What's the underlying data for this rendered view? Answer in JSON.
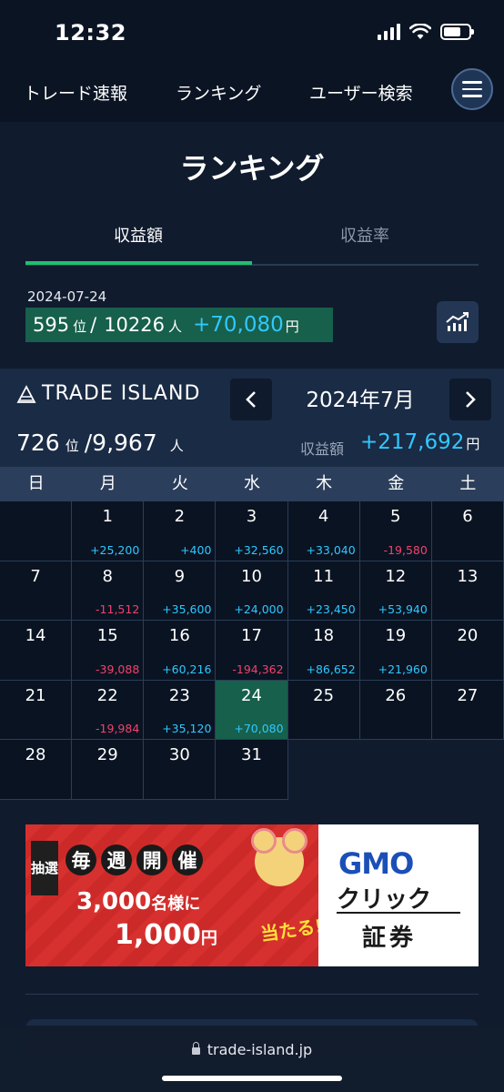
{
  "status_bar": {
    "time": "12:32"
  },
  "nav": {
    "items": [
      {
        "label": "トレード速報"
      },
      {
        "label": "ランキング"
      },
      {
        "label": "ユーザー検索"
      }
    ],
    "menu_icon": "hamburger-icon"
  },
  "page": {
    "title": "ランキング"
  },
  "tabs": [
    {
      "label": "収益額",
      "active": true
    },
    {
      "label": "収益率",
      "active": false
    }
  ],
  "daily_rank": {
    "date": "2024-07-24",
    "rank": "595",
    "rank_unit": "位",
    "separator": "/",
    "total": "10226",
    "total_unit": "人",
    "profit": "+70,080",
    "profit_unit": "円",
    "chart_icon": "chart-icon"
  },
  "calendar": {
    "logo": "TRADE ISLAND",
    "month": "2024年7月",
    "prev_icon": "chevron-left-icon",
    "next_icon": "chevron-right-icon",
    "rank": "726",
    "rank_unit": "位",
    "total": "/9,967",
    "total_unit": "人",
    "profit_label": "収益額",
    "profit": "+217,692",
    "profit_unit": "円",
    "weekdays": [
      "日",
      "月",
      "火",
      "水",
      "木",
      "金",
      "土"
    ],
    "leading_blanks": 1,
    "days": [
      {
        "day": "1",
        "profit": "+25,200"
      },
      {
        "day": "2",
        "profit": "+400"
      },
      {
        "day": "3",
        "profit": "+32,560"
      },
      {
        "day": "4",
        "profit": "+33,040"
      },
      {
        "day": "5",
        "profit": "-19,580"
      },
      {
        "day": "6",
        "profit": ""
      },
      {
        "day": "7",
        "profit": ""
      },
      {
        "day": "8",
        "profit": "-11,512"
      },
      {
        "day": "9",
        "profit": "+35,600"
      },
      {
        "day": "10",
        "profit": "+24,000"
      },
      {
        "day": "11",
        "profit": "+23,450"
      },
      {
        "day": "12",
        "profit": "+53,940"
      },
      {
        "day": "13",
        "profit": ""
      },
      {
        "day": "14",
        "profit": ""
      },
      {
        "day": "15",
        "profit": "-39,088"
      },
      {
        "day": "16",
        "profit": "+60,216"
      },
      {
        "day": "17",
        "profit": "-194,362"
      },
      {
        "day": "18",
        "profit": "+86,652"
      },
      {
        "day": "19",
        "profit": "+21,960"
      },
      {
        "day": "20",
        "profit": ""
      },
      {
        "day": "21",
        "profit": ""
      },
      {
        "day": "22",
        "profit": "-19,984"
      },
      {
        "day": "23",
        "profit": "+35,120"
      },
      {
        "day": "24",
        "profit": "+70,080",
        "today": true
      },
      {
        "day": "25",
        "profit": ""
      },
      {
        "day": "26",
        "profit": ""
      },
      {
        "day": "27",
        "profit": ""
      },
      {
        "day": "28",
        "profit": ""
      },
      {
        "day": "29",
        "profit": ""
      },
      {
        "day": "30",
        "profit": ""
      },
      {
        "day": "31",
        "profit": ""
      }
    ],
    "colors": {
      "positive": "#2fc8ff",
      "negative": "#f0436b",
      "today_bg": "#17604b"
    }
  },
  "banner": {
    "lottery": "抽選",
    "weekly": [
      "毎",
      "週",
      "開",
      "催"
    ],
    "line1": "3,000",
    "line1_unit": "名様に",
    "line2": "1,000",
    "line2_unit": "円",
    "hit": "当たる!",
    "brand_top": "GMO",
    "brand_mid": "クリック",
    "brand_bottom": "証券"
  },
  "browser": {
    "url": "trade-island.jp"
  }
}
